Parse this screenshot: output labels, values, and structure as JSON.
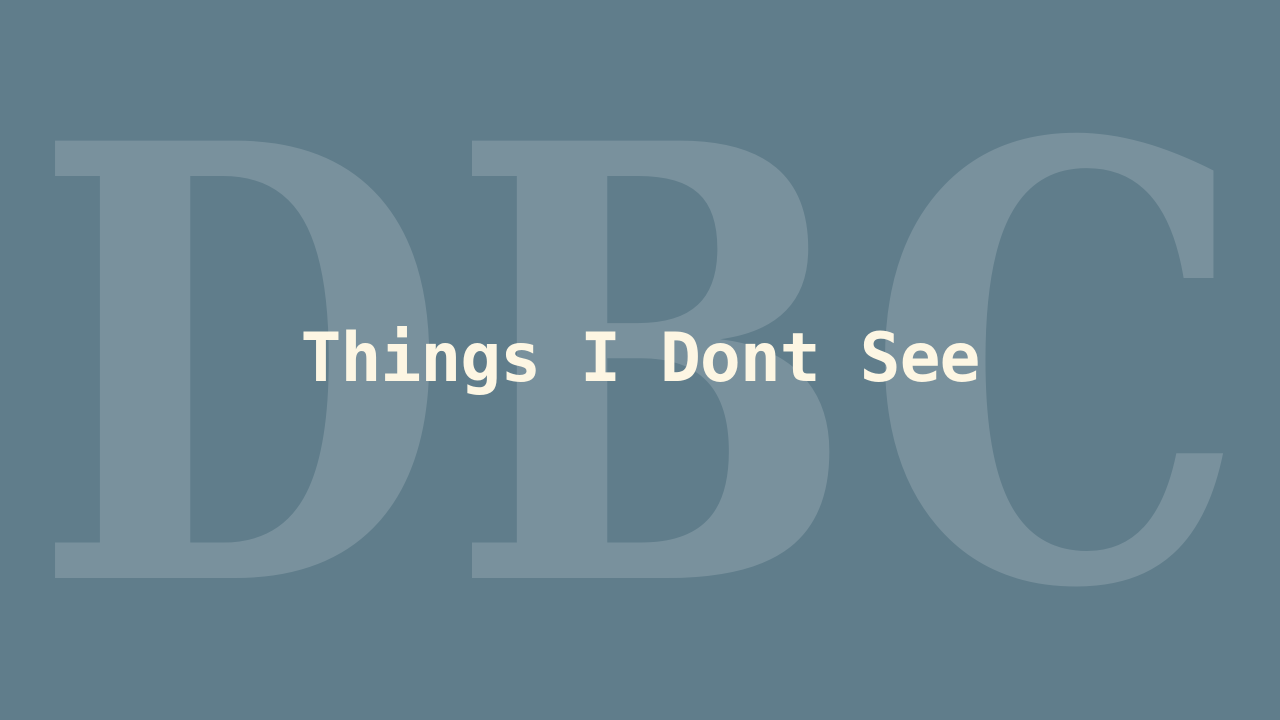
{
  "watermark": {
    "text": "DBC",
    "color": "#ffffff"
  },
  "title": {
    "text": "Things I Dont See",
    "color": "#fdf6e3"
  },
  "background_color": "#607d8b"
}
